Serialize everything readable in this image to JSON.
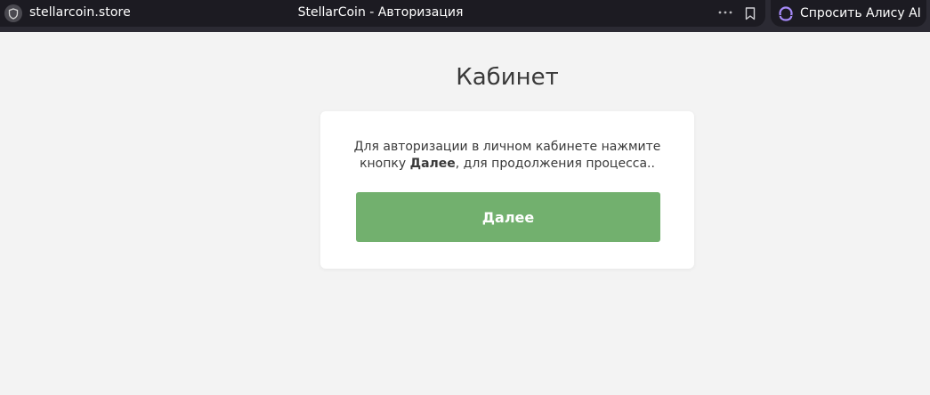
{
  "browser": {
    "domain": "stellarcoin.store",
    "tab_title": "StellarCoin - Авторизация",
    "alice_label": "Спросить Алису AI",
    "icons": {
      "site_info": "shield-icon",
      "more": "more-dots-icon",
      "bookmark": "bookmark-icon",
      "alice": "alice-icon"
    }
  },
  "page": {
    "title": "Кабинет",
    "message_before": "Для авторизации в личном кабинете нажмите кнопку ",
    "message_bold": "Далее",
    "message_after": ", для продолжения процесса..",
    "next_button": "Далее"
  },
  "colors": {
    "background": "#f3f3f3",
    "topbar": "#2b2a33",
    "button": "#72b06e",
    "alice_accent": "#a78bfa"
  }
}
